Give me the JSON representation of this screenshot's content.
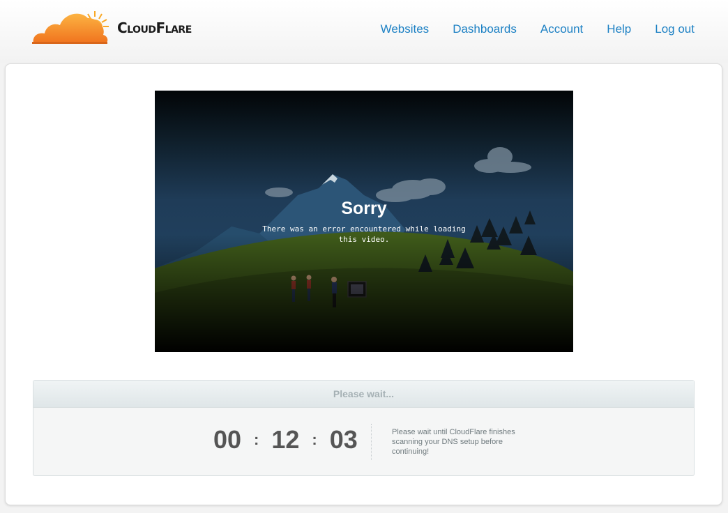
{
  "brand": {
    "name": "CloudFlare",
    "logo_icon": "cloud-sun-logo-icon"
  },
  "nav": [
    {
      "label": "Websites"
    },
    {
      "label": "Dashboards"
    },
    {
      "label": "Account"
    },
    {
      "label": "Help"
    },
    {
      "label": "Log out"
    }
  ],
  "video": {
    "title": "Sorry",
    "message": "There was an error encountered while loading this video."
  },
  "wait": {
    "header": "Please wait...",
    "timer": {
      "hours": "00",
      "minutes": "12",
      "seconds": "03",
      "separator": ":"
    },
    "message": "Please wait until CloudFlare finishes scanning your DNS setup before continuing!"
  },
  "colors": {
    "link": "#1d81c4",
    "brand_orange": "#f38020"
  }
}
